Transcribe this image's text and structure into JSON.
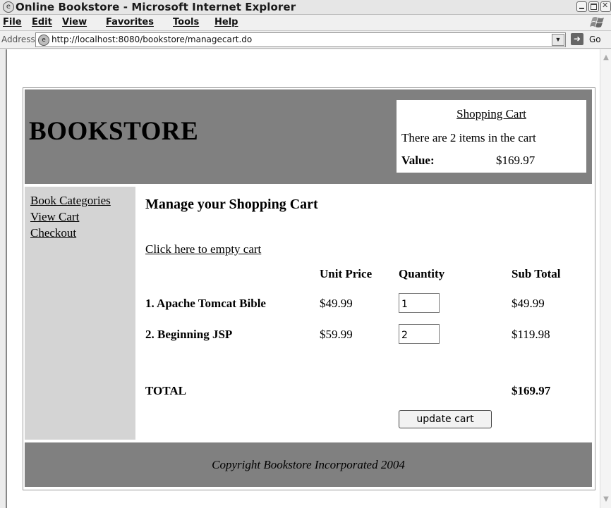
{
  "window": {
    "title": "Online Bookstore - Microsoft Internet Explorer",
    "menu": [
      "File",
      "Edit",
      "View",
      "Favorites",
      "Tools",
      "Help"
    ],
    "address_label": "Address",
    "url": "http://localhost:8080/bookstore/managecart.do",
    "go_label": "Go"
  },
  "header": {
    "brand": "BOOKSTORE",
    "cart_title": "Shopping Cart",
    "cart_count": "There are 2 items in the cart",
    "value_label": "Value:",
    "value": "$169.97"
  },
  "sidebar": {
    "items": [
      "Book Categories",
      "View Cart",
      "Checkout"
    ]
  },
  "main": {
    "title": "Manage your Shopping Cart",
    "empty_cart_link": "Click here to empty cart",
    "columns": {
      "unit_price": "Unit Price",
      "quantity": "Quantity",
      "sub_total": "Sub Total"
    },
    "rows": [
      {
        "name": "1. Apache Tomcat Bible",
        "price": "$49.99",
        "qty": "1",
        "subtotal": "$49.99"
      },
      {
        "name": "2. Beginning JSP",
        "price": "$59.99",
        "qty": "2",
        "subtotal": "$119.98"
      }
    ],
    "total_label": "TOTAL",
    "total_value": "$169.97",
    "update_button": "update cart"
  },
  "footer": {
    "copyright": "Copyright Bookstore Incorporated 2004"
  }
}
